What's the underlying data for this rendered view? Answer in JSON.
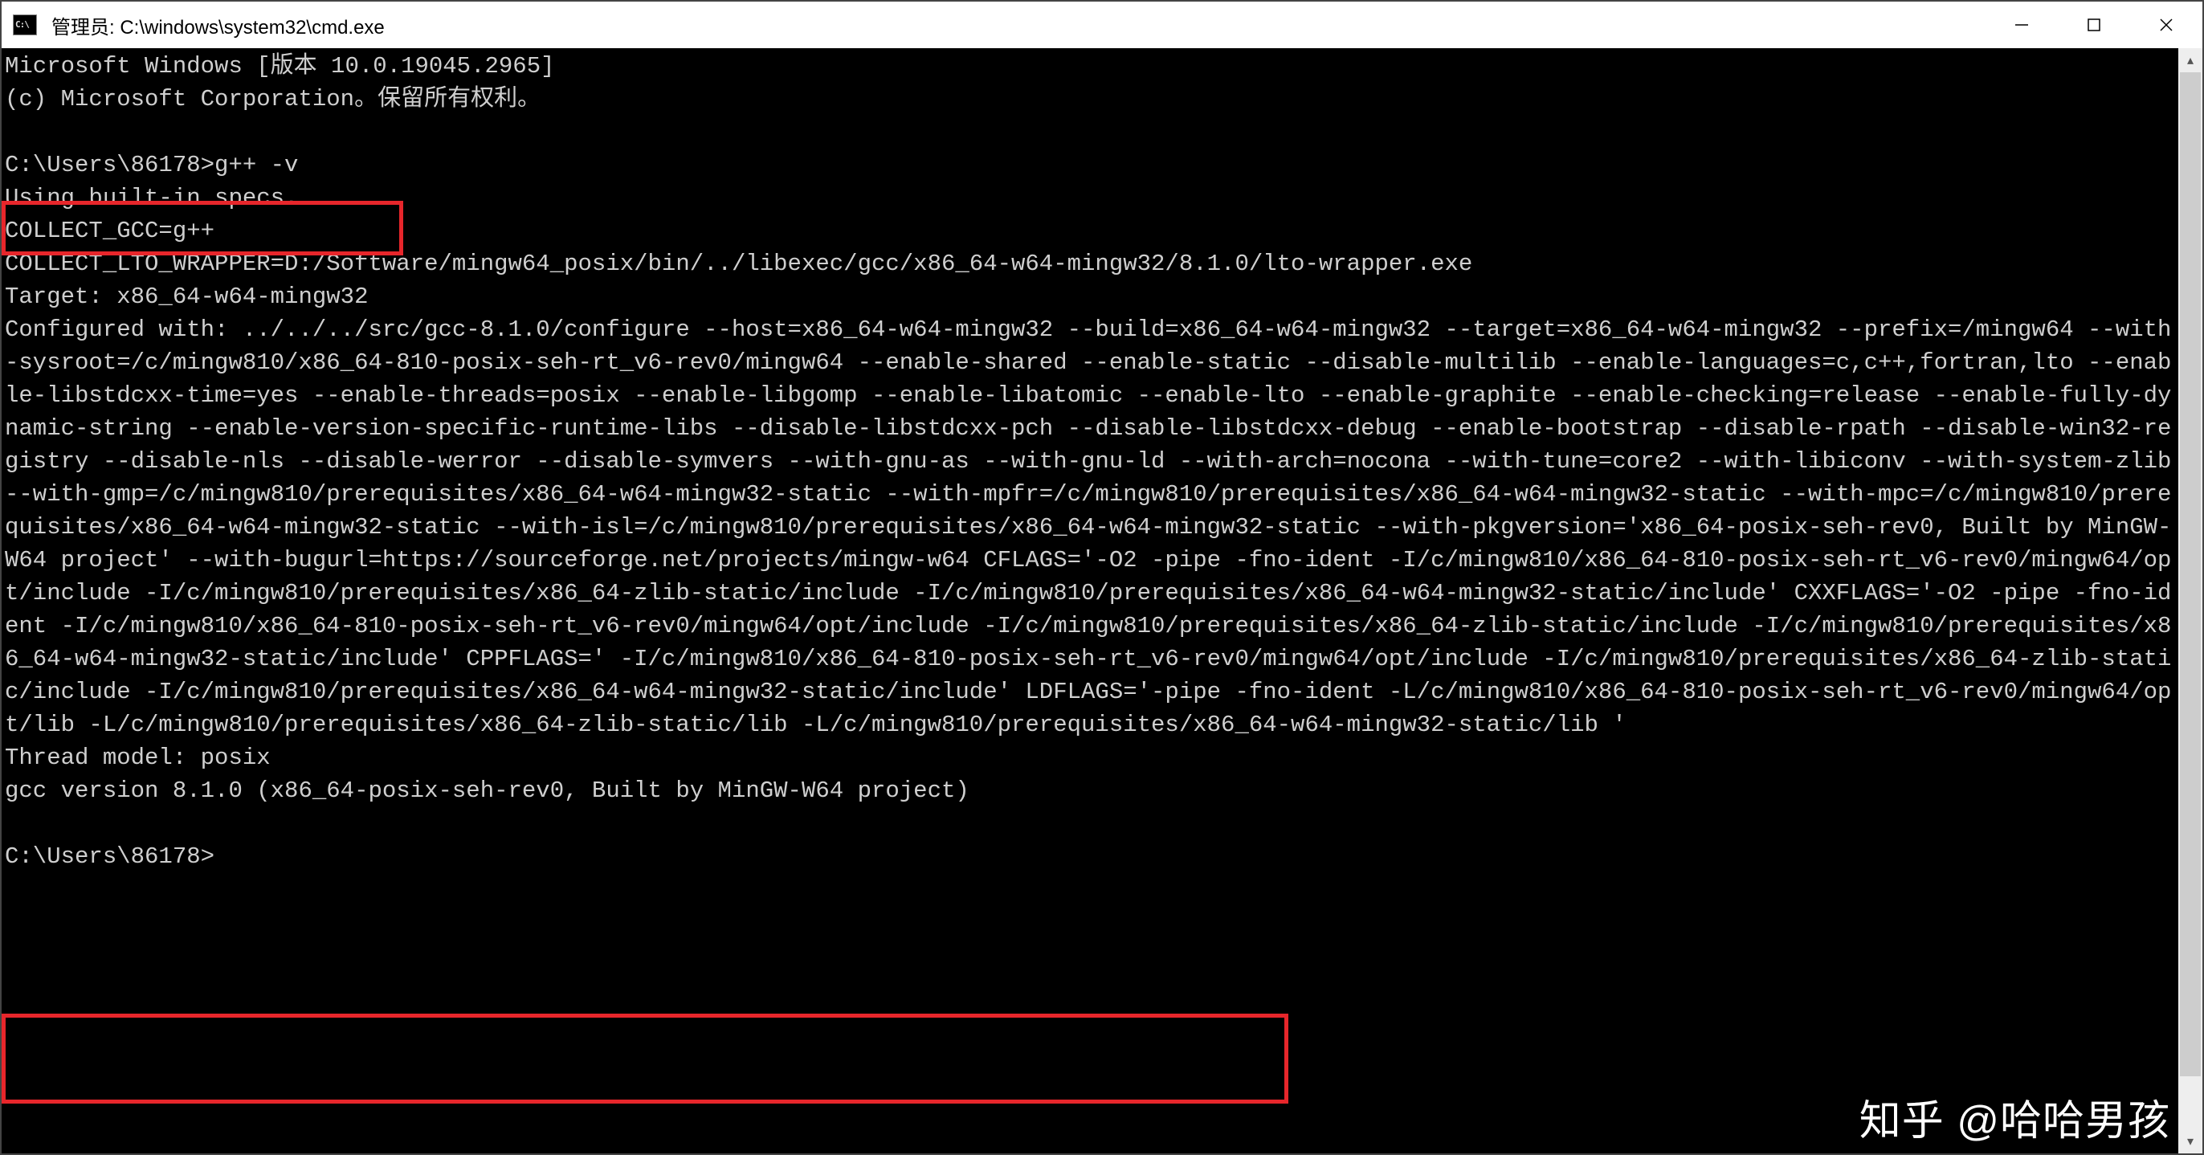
{
  "window": {
    "title": "管理员: C:\\windows\\system32\\cmd.exe",
    "icon": "cmd-icon",
    "controls": {
      "minimize": "—",
      "maximize": "□",
      "close": "✕"
    }
  },
  "terminal": {
    "header_line1": "Microsoft Windows [版本 10.0.19045.2965]",
    "header_line2": "(c) Microsoft Corporation。保留所有权利。",
    "prompt1": "C:\\Users\\86178>g++ -v",
    "body": "Using built-in specs.\nCOLLECT_GCC=g++\nCOLLECT_LTO_WRAPPER=D:/Software/mingw64_posix/bin/../libexec/gcc/x86_64-w64-mingw32/8.1.0/lto-wrapper.exe\nTarget: x86_64-w64-mingw32\nConfigured with: ../../../src/gcc-8.1.0/configure --host=x86_64-w64-mingw32 --build=x86_64-w64-mingw32 --target=x86_64-w64-mingw32 --prefix=/mingw64 --with-sysroot=/c/mingw810/x86_64-810-posix-seh-rt_v6-rev0/mingw64 --enable-shared --enable-static --disable-multilib --enable-languages=c,c++,fortran,lto --enable-libstdcxx-time=yes --enable-threads=posix --enable-libgomp --enable-libatomic --enable-lto --enable-graphite --enable-checking=release --enable-fully-dynamic-string --enable-version-specific-runtime-libs --disable-libstdcxx-pch --disable-libstdcxx-debug --enable-bootstrap --disable-rpath --disable-win32-registry --disable-nls --disable-werror --disable-symvers --with-gnu-as --with-gnu-ld --with-arch=nocona --with-tune=core2 --with-libiconv --with-system-zlib --with-gmp=/c/mingw810/prerequisites/x86_64-w64-mingw32-static --with-mpfr=/c/mingw810/prerequisites/x86_64-w64-mingw32-static --with-mpc=/c/mingw810/prerequisites/x86_64-w64-mingw32-static --with-isl=/c/mingw810/prerequisites/x86_64-w64-mingw32-static --with-pkgversion='x86_64-posix-seh-rev0, Built by MinGW-W64 project' --with-bugurl=https://sourceforge.net/projects/mingw-w64 CFLAGS='-O2 -pipe -fno-ident -I/c/mingw810/x86_64-810-posix-seh-rt_v6-rev0/mingw64/opt/include -I/c/mingw810/prerequisites/x86_64-zlib-static/include -I/c/mingw810/prerequisites/x86_64-w64-mingw32-static/include' CXXFLAGS='-O2 -pipe -fno-ident -I/c/mingw810/x86_64-810-posix-seh-rt_v6-rev0/mingw64/opt/include -I/c/mingw810/prerequisites/x86_64-zlib-static/include -I/c/mingw810/prerequisites/x86_64-w64-mingw32-static/include' CPPFLAGS=' -I/c/mingw810/x86_64-810-posix-seh-rt_v6-rev0/mingw64/opt/include -I/c/mingw810/prerequisites/x86_64-zlib-static/include -I/c/mingw810/prerequisites/x86_64-w64-mingw32-static/include' LDFLAGS='-pipe -fno-ident -L/c/mingw810/x86_64-810-posix-seh-rt_v6-rev0/mingw64/opt/lib -L/c/mingw810/prerequisites/x86_64-zlib-static/lib -L/c/mingw810/prerequisites/x86_64-w64-mingw32-static/lib '",
    "tail_line1": "Thread model: posix",
    "tail_line2": "gcc version 8.1.0 (x86_64-posix-seh-rev0, Built by MinGW-W64 project)",
    "prompt2": "C:\\Users\\86178>"
  },
  "watermark": "知乎 @哈哈男孩"
}
